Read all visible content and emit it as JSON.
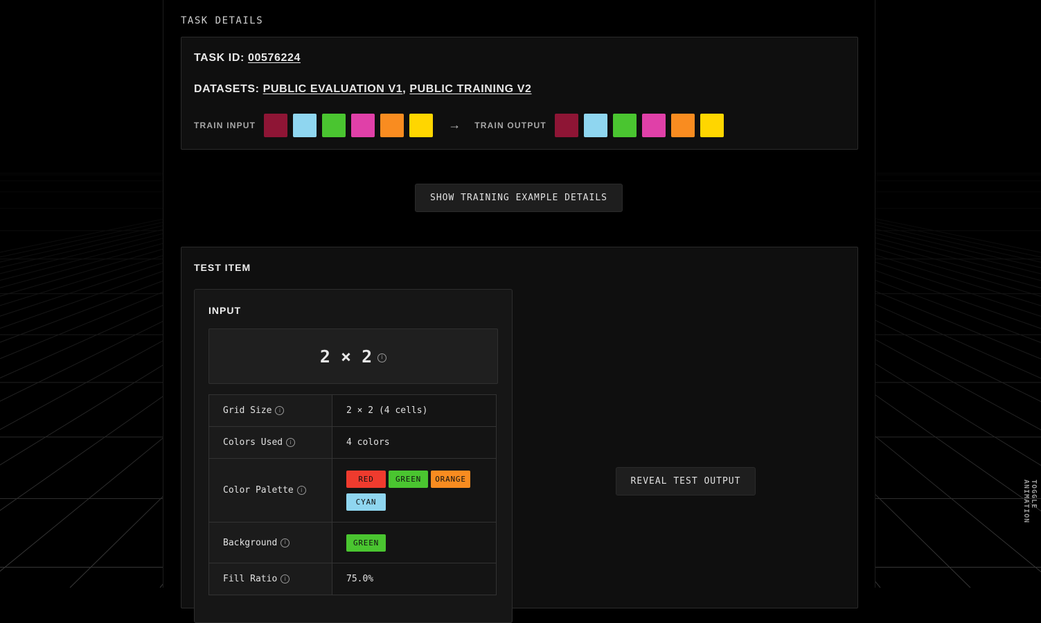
{
  "section_label": "TASK DETAILS",
  "task": {
    "id_label": "TASK ID:",
    "id_value": "00576224",
    "datasets_label": "DATASETS:",
    "datasets": [
      "PUBLIC EVALUATION V1",
      "PUBLIC TRAINING V2"
    ],
    "dataset_separator": ",",
    "train_input_label": "TRAIN INPUT",
    "train_output_label": "TRAIN OUTPUT",
    "arrow_icon": "arrow-right-icon",
    "train_input_colors": [
      "#8e1535",
      "#8fd6f0",
      "#4ac530",
      "#e040a8",
      "#f98c20",
      "#ffd600"
    ],
    "train_output_colors": [
      "#8e1535",
      "#8fd6f0",
      "#4ac530",
      "#e040a8",
      "#f98c20",
      "#ffd600"
    ]
  },
  "show_training_button": "SHOW TRAINING EXAMPLE DETAILS",
  "test_item": {
    "title": "TEST ITEM",
    "input": {
      "title": "INPUT",
      "dims": "2 × 2",
      "stats": [
        {
          "key": "Grid Size",
          "value": "2 × 2 (4 cells)"
        },
        {
          "key": "Colors Used",
          "value": "4 colors"
        },
        {
          "key": "Color Palette",
          "chips": [
            {
              "label": "RED",
              "color": "#ef3b2e"
            },
            {
              "label": "GREEN",
              "color": "#4ac530"
            },
            {
              "label": "ORANGE",
              "color": "#f98c20"
            },
            {
              "label": "CYAN",
              "color": "#8fd6f0"
            }
          ]
        },
        {
          "key": "Background",
          "chips": [
            {
              "label": "GREEN",
              "color": "#4ac530"
            }
          ]
        },
        {
          "key": "Fill Ratio",
          "value": "75.0%"
        }
      ]
    },
    "reveal_button": "REVEAL TEST OUTPUT"
  },
  "toggle_animation": "TOGGLE ANIMATION"
}
